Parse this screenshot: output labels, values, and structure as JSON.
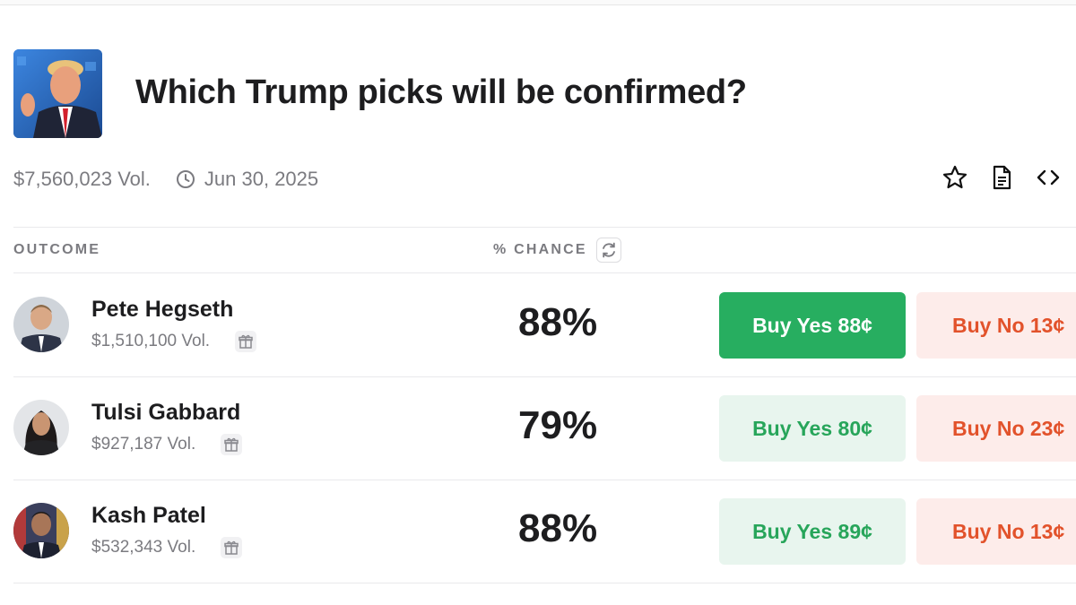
{
  "market": {
    "title": "Which Trump picks will be confirmed?",
    "volume": "$7,560,023 Vol.",
    "end_date": "Jun 30, 2025"
  },
  "actions": {
    "icons": [
      "star-icon",
      "document-icon",
      "code-icon"
    ]
  },
  "table": {
    "col_outcome": "OUTCOME",
    "col_chance": "% CHANCE"
  },
  "outcomes": [
    {
      "name": "Pete Hegseth",
      "volume": "$1,510,100 Vol.",
      "chance": "88%",
      "buy_yes": "Buy Yes 88¢",
      "buy_no": "Buy No 13¢"
    },
    {
      "name": "Tulsi Gabbard",
      "volume": "$927,187 Vol.",
      "chance": "79%",
      "buy_yes": "Buy Yes 80¢",
      "buy_no": "Buy No 23¢"
    },
    {
      "name": "Kash Patel",
      "volume": "$532,343 Vol.",
      "chance": "88%",
      "buy_yes": "Buy Yes 89¢",
      "buy_no": "Buy No 13¢"
    }
  ],
  "colors": {
    "yes_active": "#27ae60",
    "yes_text": "#27a55a",
    "no_text": "#e2522b",
    "muted": "#7b7b80"
  }
}
